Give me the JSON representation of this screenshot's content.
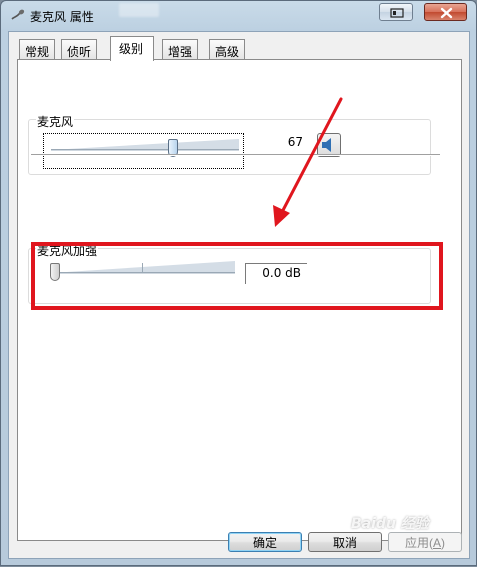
{
  "window": {
    "title": "麦克风 属性",
    "icons": {
      "app": "microphone-icon",
      "help": "help-icon",
      "close": "close-icon"
    },
    "colors": {
      "close_button": "#c9553c",
      "titlebar": "#bcd0e1"
    }
  },
  "tabs": [
    {
      "label": "常规",
      "active": false
    },
    {
      "label": "侦听",
      "active": false
    },
    {
      "label": "级别",
      "active": true
    },
    {
      "label": "增强",
      "active": false
    },
    {
      "label": "高级",
      "active": false
    }
  ],
  "levels": {
    "microphone": {
      "label": "麦克风",
      "value_text": "67",
      "level": 67,
      "range": [
        0,
        100
      ],
      "mute_icon": "speaker-icon"
    },
    "boost": {
      "label": "麦克风加强",
      "value_text": "0.0 dB",
      "level": 0.0
    }
  },
  "annotation": {
    "highlight_color": "#e0161e"
  },
  "buttons": {
    "ok": "确定",
    "cancel": "取消",
    "apply": "应用",
    "apply_mnemonic": "A"
  },
  "watermark": {
    "text": "Baidu 经验"
  }
}
